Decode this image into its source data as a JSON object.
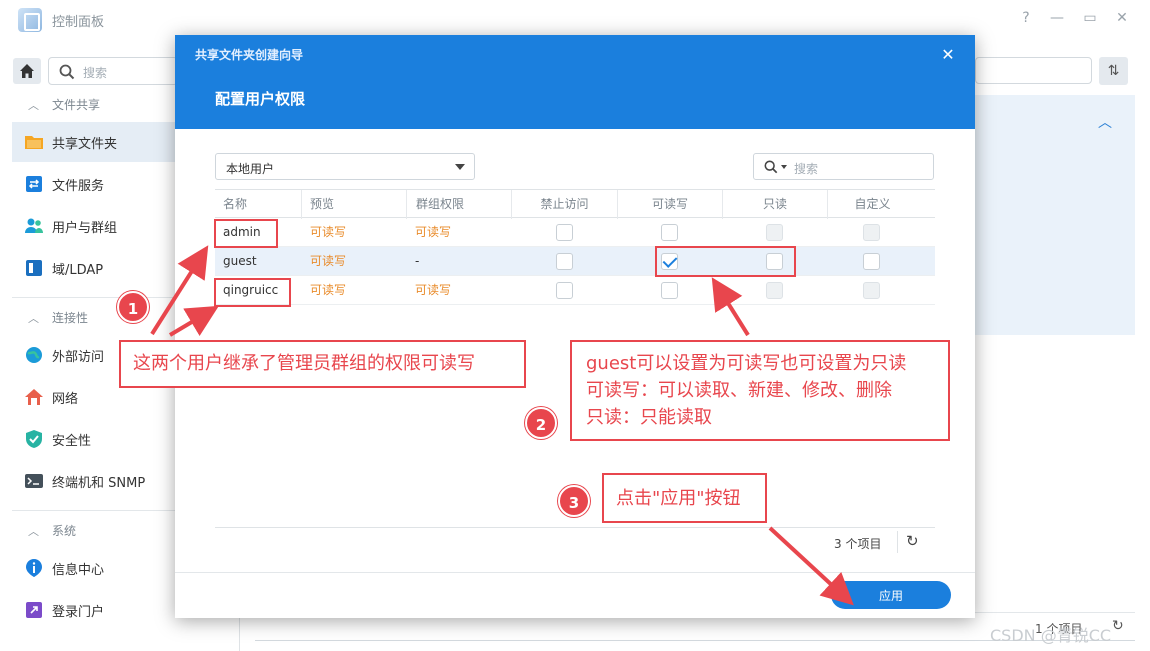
{
  "app": {
    "title": "控制面板",
    "window_controls": [
      "?",
      "—",
      "▭",
      "✕"
    ]
  },
  "toolbar": {
    "search_placeholder": "搜索",
    "sort_icon": "sort-icon"
  },
  "sidebar": {
    "sections": [
      {
        "title": "文件共享"
      },
      {
        "title": "连接性"
      },
      {
        "title": "系统"
      }
    ],
    "items": [
      {
        "label": "共享文件夹",
        "icon": "folder-share-icon",
        "active": true
      },
      {
        "label": "文件服务",
        "icon": "file-services-icon"
      },
      {
        "label": "用户与群组",
        "icon": "users-icon"
      },
      {
        "label": "域/LDAP",
        "icon": "domain-icon"
      },
      {
        "label": "外部访问",
        "icon": "globe-icon"
      },
      {
        "label": "网络",
        "icon": "network-icon"
      },
      {
        "label": "安全性",
        "icon": "shield-icon"
      },
      {
        "label": "终端机和 SNMP",
        "icon": "terminal-icon"
      },
      {
        "label": "信息中心",
        "icon": "info-icon"
      },
      {
        "label": "登录门户",
        "icon": "portal-icon"
      }
    ]
  },
  "background": {
    "count_text": "1 个项目"
  },
  "wizard": {
    "title": "共享文件夹创建向导",
    "step_title": "配置用户权限",
    "user_select": "本地用户",
    "search_placeholder": "搜索",
    "columns": [
      "名称",
      "预览",
      "群组权限",
      "禁止访问",
      "可读写",
      "只读",
      "自定义"
    ],
    "rows": [
      {
        "name": "admin",
        "preview": "可读写",
        "group_permission": "可读写",
        "deny": false,
        "read_write": false,
        "read_only": false,
        "custom": false
      },
      {
        "name": "guest",
        "preview": "可读写",
        "group_permission": "-",
        "deny": false,
        "read_write": true,
        "read_only": false,
        "custom": false
      },
      {
        "name": "qingruicc",
        "preview": "可读写",
        "group_permission": "可读写",
        "deny": false,
        "read_write": false,
        "read_only": false,
        "custom": false
      }
    ],
    "count_text": "3 个项目",
    "apply_label": "应用"
  },
  "annotations": {
    "note1": {
      "number": "1",
      "text": "这两个用户继承了管理员群组的权限可读写"
    },
    "note2": {
      "number": "2",
      "lines": [
        "guest可以设置为可读写也可设置为只读",
        "可读写：可以读取、新建、修改、删除",
        "只读：只能读取"
      ]
    },
    "note3": {
      "number": "3",
      "text": "点击\"应用\"按钮"
    },
    "color": "#e8464d"
  },
  "watermark": "CSDN @青锐CC",
  "colors": {
    "accent": "#1b7fdd",
    "permission_text": "#e98b2a",
    "annotation": "#e8464d"
  }
}
